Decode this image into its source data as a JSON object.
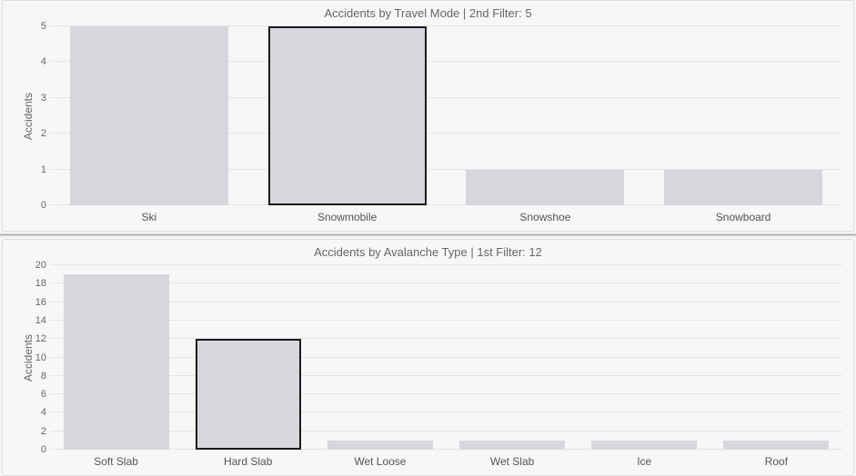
{
  "chart_data": [
    {
      "type": "bar",
      "title": "Accidents by Travel Mode | 2nd Filter: 5",
      "xlabel": "",
      "ylabel": "Accidents",
      "ylim": [
        0,
        5
      ],
      "yticks": [
        0,
        1,
        2,
        3,
        4,
        5
      ],
      "categories": [
        "Ski",
        "Snowmobile",
        "Snowshoe",
        "Snowboard"
      ],
      "values": [
        5,
        5,
        1,
        1
      ],
      "selected_index": 1
    },
    {
      "type": "bar",
      "title": "Accidents by Avalanche Type | 1st Filter: 12",
      "xlabel": "",
      "ylabel": "Accidents",
      "ylim": [
        0,
        20
      ],
      "yticks": [
        0,
        2,
        4,
        6,
        8,
        10,
        12,
        14,
        16,
        18,
        20
      ],
      "categories": [
        "Soft Slab",
        "Hard Slab",
        "Wet Loose",
        "Wet Slab",
        "Ice",
        "Roof"
      ],
      "values": [
        19,
        12,
        1,
        1,
        1,
        1
      ],
      "selected_index": 1
    }
  ]
}
